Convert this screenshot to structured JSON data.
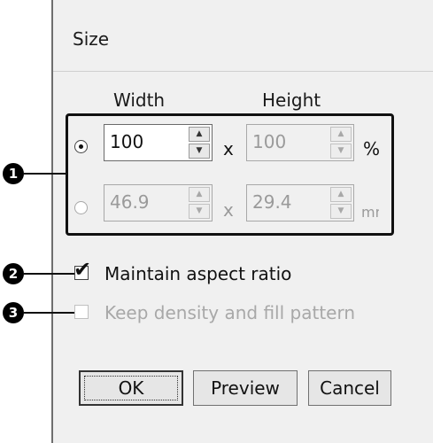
{
  "dialog": {
    "title": "Size"
  },
  "columns": {
    "width_label": "Width",
    "height_label": "Height"
  },
  "percent_row": {
    "selected": true,
    "width_value": "100",
    "separator": "x",
    "height_value": "100",
    "unit": "%"
  },
  "mm_row": {
    "selected": false,
    "width_value": "46.9",
    "separator": "x",
    "height_value": "29.4",
    "unit": "mm"
  },
  "options": {
    "maintain_aspect": {
      "label": "Maintain aspect ratio",
      "checked": true,
      "enabled": true
    },
    "keep_density": {
      "label": "Keep density and fill pattern",
      "checked": false,
      "enabled": false
    }
  },
  "buttons": {
    "ok": "OK",
    "preview": "Preview",
    "cancel": "Cancel"
  },
  "callouts": {
    "first": "1",
    "second": "2",
    "third": "3"
  },
  "icons": {
    "spin_up": "triangle-up",
    "spin_down": "triangle-down",
    "check": "checkmark"
  }
}
